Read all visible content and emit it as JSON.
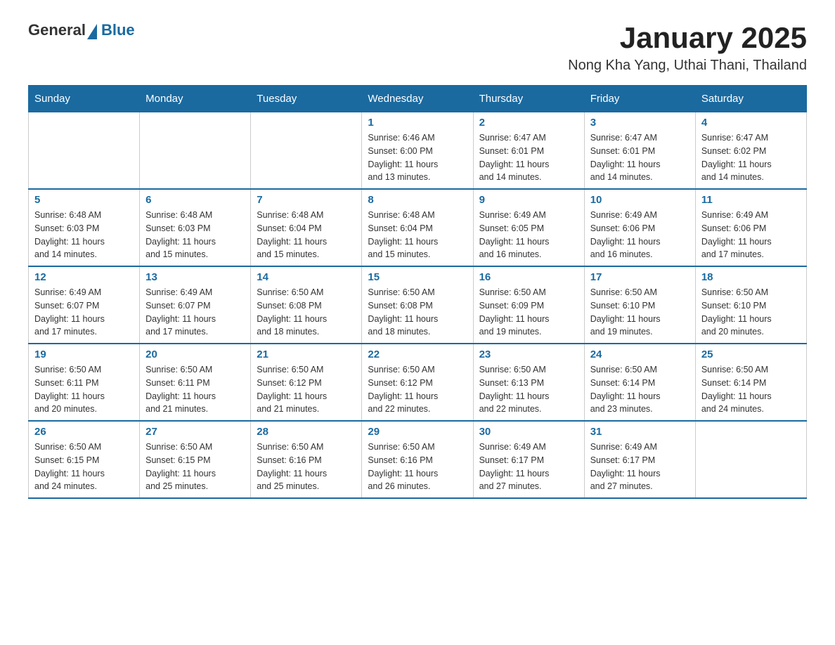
{
  "header": {
    "logo_general": "General",
    "logo_blue": "Blue",
    "title": "January 2025",
    "subtitle": "Nong Kha Yang, Uthai Thani, Thailand"
  },
  "days_of_week": [
    "Sunday",
    "Monday",
    "Tuesday",
    "Wednesday",
    "Thursday",
    "Friday",
    "Saturday"
  ],
  "weeks": [
    [
      {
        "day": "",
        "info": ""
      },
      {
        "day": "",
        "info": ""
      },
      {
        "day": "",
        "info": ""
      },
      {
        "day": "1",
        "info": "Sunrise: 6:46 AM\nSunset: 6:00 PM\nDaylight: 11 hours\nand 13 minutes."
      },
      {
        "day": "2",
        "info": "Sunrise: 6:47 AM\nSunset: 6:01 PM\nDaylight: 11 hours\nand 14 minutes."
      },
      {
        "day": "3",
        "info": "Sunrise: 6:47 AM\nSunset: 6:01 PM\nDaylight: 11 hours\nand 14 minutes."
      },
      {
        "day": "4",
        "info": "Sunrise: 6:47 AM\nSunset: 6:02 PM\nDaylight: 11 hours\nand 14 minutes."
      }
    ],
    [
      {
        "day": "5",
        "info": "Sunrise: 6:48 AM\nSunset: 6:03 PM\nDaylight: 11 hours\nand 14 minutes."
      },
      {
        "day": "6",
        "info": "Sunrise: 6:48 AM\nSunset: 6:03 PM\nDaylight: 11 hours\nand 15 minutes."
      },
      {
        "day": "7",
        "info": "Sunrise: 6:48 AM\nSunset: 6:04 PM\nDaylight: 11 hours\nand 15 minutes."
      },
      {
        "day": "8",
        "info": "Sunrise: 6:48 AM\nSunset: 6:04 PM\nDaylight: 11 hours\nand 15 minutes."
      },
      {
        "day": "9",
        "info": "Sunrise: 6:49 AM\nSunset: 6:05 PM\nDaylight: 11 hours\nand 16 minutes."
      },
      {
        "day": "10",
        "info": "Sunrise: 6:49 AM\nSunset: 6:06 PM\nDaylight: 11 hours\nand 16 minutes."
      },
      {
        "day": "11",
        "info": "Sunrise: 6:49 AM\nSunset: 6:06 PM\nDaylight: 11 hours\nand 17 minutes."
      }
    ],
    [
      {
        "day": "12",
        "info": "Sunrise: 6:49 AM\nSunset: 6:07 PM\nDaylight: 11 hours\nand 17 minutes."
      },
      {
        "day": "13",
        "info": "Sunrise: 6:49 AM\nSunset: 6:07 PM\nDaylight: 11 hours\nand 17 minutes."
      },
      {
        "day": "14",
        "info": "Sunrise: 6:50 AM\nSunset: 6:08 PM\nDaylight: 11 hours\nand 18 minutes."
      },
      {
        "day": "15",
        "info": "Sunrise: 6:50 AM\nSunset: 6:08 PM\nDaylight: 11 hours\nand 18 minutes."
      },
      {
        "day": "16",
        "info": "Sunrise: 6:50 AM\nSunset: 6:09 PM\nDaylight: 11 hours\nand 19 minutes."
      },
      {
        "day": "17",
        "info": "Sunrise: 6:50 AM\nSunset: 6:10 PM\nDaylight: 11 hours\nand 19 minutes."
      },
      {
        "day": "18",
        "info": "Sunrise: 6:50 AM\nSunset: 6:10 PM\nDaylight: 11 hours\nand 20 minutes."
      }
    ],
    [
      {
        "day": "19",
        "info": "Sunrise: 6:50 AM\nSunset: 6:11 PM\nDaylight: 11 hours\nand 20 minutes."
      },
      {
        "day": "20",
        "info": "Sunrise: 6:50 AM\nSunset: 6:11 PM\nDaylight: 11 hours\nand 21 minutes."
      },
      {
        "day": "21",
        "info": "Sunrise: 6:50 AM\nSunset: 6:12 PM\nDaylight: 11 hours\nand 21 minutes."
      },
      {
        "day": "22",
        "info": "Sunrise: 6:50 AM\nSunset: 6:12 PM\nDaylight: 11 hours\nand 22 minutes."
      },
      {
        "day": "23",
        "info": "Sunrise: 6:50 AM\nSunset: 6:13 PM\nDaylight: 11 hours\nand 22 minutes."
      },
      {
        "day": "24",
        "info": "Sunrise: 6:50 AM\nSunset: 6:14 PM\nDaylight: 11 hours\nand 23 minutes."
      },
      {
        "day": "25",
        "info": "Sunrise: 6:50 AM\nSunset: 6:14 PM\nDaylight: 11 hours\nand 24 minutes."
      }
    ],
    [
      {
        "day": "26",
        "info": "Sunrise: 6:50 AM\nSunset: 6:15 PM\nDaylight: 11 hours\nand 24 minutes."
      },
      {
        "day": "27",
        "info": "Sunrise: 6:50 AM\nSunset: 6:15 PM\nDaylight: 11 hours\nand 25 minutes."
      },
      {
        "day": "28",
        "info": "Sunrise: 6:50 AM\nSunset: 6:16 PM\nDaylight: 11 hours\nand 25 minutes."
      },
      {
        "day": "29",
        "info": "Sunrise: 6:50 AM\nSunset: 6:16 PM\nDaylight: 11 hours\nand 26 minutes."
      },
      {
        "day": "30",
        "info": "Sunrise: 6:49 AM\nSunset: 6:17 PM\nDaylight: 11 hours\nand 27 minutes."
      },
      {
        "day": "31",
        "info": "Sunrise: 6:49 AM\nSunset: 6:17 PM\nDaylight: 11 hours\nand 27 minutes."
      },
      {
        "day": "",
        "info": ""
      }
    ]
  ]
}
